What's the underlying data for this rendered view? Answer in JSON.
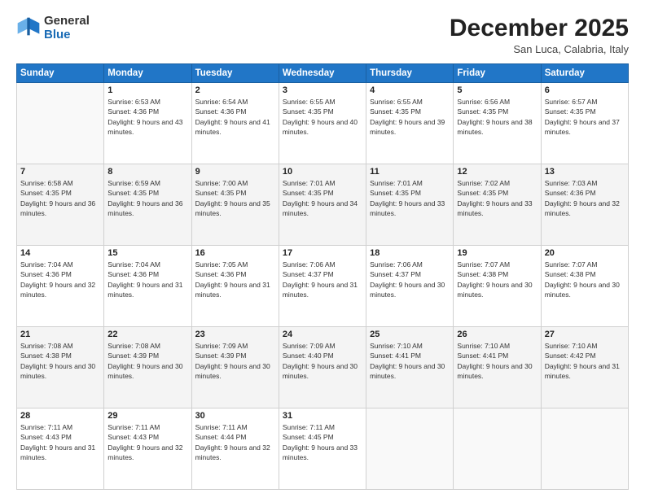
{
  "logo": {
    "general": "General",
    "blue": "Blue"
  },
  "header": {
    "month": "December 2025",
    "location": "San Luca, Calabria, Italy"
  },
  "weekdays": [
    "Sunday",
    "Monday",
    "Tuesday",
    "Wednesday",
    "Thursday",
    "Friday",
    "Saturday"
  ],
  "weeks": [
    [
      {
        "day": "",
        "sunrise": "",
        "sunset": "",
        "daylight": ""
      },
      {
        "day": "1",
        "sunrise": "Sunrise: 6:53 AM",
        "sunset": "Sunset: 4:36 PM",
        "daylight": "Daylight: 9 hours and 43 minutes."
      },
      {
        "day": "2",
        "sunrise": "Sunrise: 6:54 AM",
        "sunset": "Sunset: 4:36 PM",
        "daylight": "Daylight: 9 hours and 41 minutes."
      },
      {
        "day": "3",
        "sunrise": "Sunrise: 6:55 AM",
        "sunset": "Sunset: 4:35 PM",
        "daylight": "Daylight: 9 hours and 40 minutes."
      },
      {
        "day": "4",
        "sunrise": "Sunrise: 6:55 AM",
        "sunset": "Sunset: 4:35 PM",
        "daylight": "Daylight: 9 hours and 39 minutes."
      },
      {
        "day": "5",
        "sunrise": "Sunrise: 6:56 AM",
        "sunset": "Sunset: 4:35 PM",
        "daylight": "Daylight: 9 hours and 38 minutes."
      },
      {
        "day": "6",
        "sunrise": "Sunrise: 6:57 AM",
        "sunset": "Sunset: 4:35 PM",
        "daylight": "Daylight: 9 hours and 37 minutes."
      }
    ],
    [
      {
        "day": "7",
        "sunrise": "Sunrise: 6:58 AM",
        "sunset": "Sunset: 4:35 PM",
        "daylight": "Daylight: 9 hours and 36 minutes."
      },
      {
        "day": "8",
        "sunrise": "Sunrise: 6:59 AM",
        "sunset": "Sunset: 4:35 PM",
        "daylight": "Daylight: 9 hours and 36 minutes."
      },
      {
        "day": "9",
        "sunrise": "Sunrise: 7:00 AM",
        "sunset": "Sunset: 4:35 PM",
        "daylight": "Daylight: 9 hours and 35 minutes."
      },
      {
        "day": "10",
        "sunrise": "Sunrise: 7:01 AM",
        "sunset": "Sunset: 4:35 PM",
        "daylight": "Daylight: 9 hours and 34 minutes."
      },
      {
        "day": "11",
        "sunrise": "Sunrise: 7:01 AM",
        "sunset": "Sunset: 4:35 PM",
        "daylight": "Daylight: 9 hours and 33 minutes."
      },
      {
        "day": "12",
        "sunrise": "Sunrise: 7:02 AM",
        "sunset": "Sunset: 4:35 PM",
        "daylight": "Daylight: 9 hours and 33 minutes."
      },
      {
        "day": "13",
        "sunrise": "Sunrise: 7:03 AM",
        "sunset": "Sunset: 4:36 PM",
        "daylight": "Daylight: 9 hours and 32 minutes."
      }
    ],
    [
      {
        "day": "14",
        "sunrise": "Sunrise: 7:04 AM",
        "sunset": "Sunset: 4:36 PM",
        "daylight": "Daylight: 9 hours and 32 minutes."
      },
      {
        "day": "15",
        "sunrise": "Sunrise: 7:04 AM",
        "sunset": "Sunset: 4:36 PM",
        "daylight": "Daylight: 9 hours and 31 minutes."
      },
      {
        "day": "16",
        "sunrise": "Sunrise: 7:05 AM",
        "sunset": "Sunset: 4:36 PM",
        "daylight": "Daylight: 9 hours and 31 minutes."
      },
      {
        "day": "17",
        "sunrise": "Sunrise: 7:06 AM",
        "sunset": "Sunset: 4:37 PM",
        "daylight": "Daylight: 9 hours and 31 minutes."
      },
      {
        "day": "18",
        "sunrise": "Sunrise: 7:06 AM",
        "sunset": "Sunset: 4:37 PM",
        "daylight": "Daylight: 9 hours and 30 minutes."
      },
      {
        "day": "19",
        "sunrise": "Sunrise: 7:07 AM",
        "sunset": "Sunset: 4:38 PM",
        "daylight": "Daylight: 9 hours and 30 minutes."
      },
      {
        "day": "20",
        "sunrise": "Sunrise: 7:07 AM",
        "sunset": "Sunset: 4:38 PM",
        "daylight": "Daylight: 9 hours and 30 minutes."
      }
    ],
    [
      {
        "day": "21",
        "sunrise": "Sunrise: 7:08 AM",
        "sunset": "Sunset: 4:38 PM",
        "daylight": "Daylight: 9 hours and 30 minutes."
      },
      {
        "day": "22",
        "sunrise": "Sunrise: 7:08 AM",
        "sunset": "Sunset: 4:39 PM",
        "daylight": "Daylight: 9 hours and 30 minutes."
      },
      {
        "day": "23",
        "sunrise": "Sunrise: 7:09 AM",
        "sunset": "Sunset: 4:39 PM",
        "daylight": "Daylight: 9 hours and 30 minutes."
      },
      {
        "day": "24",
        "sunrise": "Sunrise: 7:09 AM",
        "sunset": "Sunset: 4:40 PM",
        "daylight": "Daylight: 9 hours and 30 minutes."
      },
      {
        "day": "25",
        "sunrise": "Sunrise: 7:10 AM",
        "sunset": "Sunset: 4:41 PM",
        "daylight": "Daylight: 9 hours and 30 minutes."
      },
      {
        "day": "26",
        "sunrise": "Sunrise: 7:10 AM",
        "sunset": "Sunset: 4:41 PM",
        "daylight": "Daylight: 9 hours and 30 minutes."
      },
      {
        "day": "27",
        "sunrise": "Sunrise: 7:10 AM",
        "sunset": "Sunset: 4:42 PM",
        "daylight": "Daylight: 9 hours and 31 minutes."
      }
    ],
    [
      {
        "day": "28",
        "sunrise": "Sunrise: 7:11 AM",
        "sunset": "Sunset: 4:43 PM",
        "daylight": "Daylight: 9 hours and 31 minutes."
      },
      {
        "day": "29",
        "sunrise": "Sunrise: 7:11 AM",
        "sunset": "Sunset: 4:43 PM",
        "daylight": "Daylight: 9 hours and 32 minutes."
      },
      {
        "day": "30",
        "sunrise": "Sunrise: 7:11 AM",
        "sunset": "Sunset: 4:44 PM",
        "daylight": "Daylight: 9 hours and 32 minutes."
      },
      {
        "day": "31",
        "sunrise": "Sunrise: 7:11 AM",
        "sunset": "Sunset: 4:45 PM",
        "daylight": "Daylight: 9 hours and 33 minutes."
      },
      {
        "day": "",
        "sunrise": "",
        "sunset": "",
        "daylight": ""
      },
      {
        "day": "",
        "sunrise": "",
        "sunset": "",
        "daylight": ""
      },
      {
        "day": "",
        "sunrise": "",
        "sunset": "",
        "daylight": ""
      }
    ]
  ]
}
